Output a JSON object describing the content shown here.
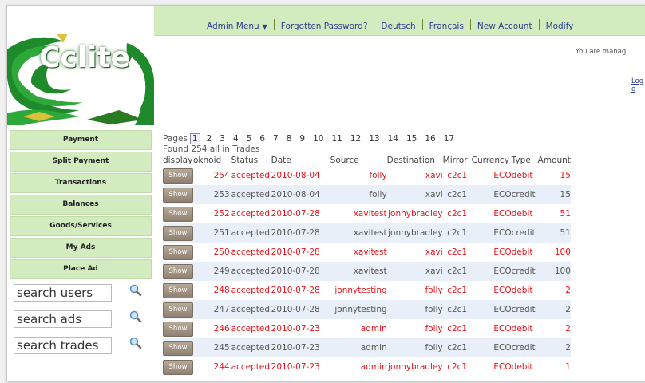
{
  "nav": {
    "items": [
      "Admin Menu",
      "Forgotten Password?",
      "Deutsch",
      "Français",
      "New Account",
      "Modify"
    ]
  },
  "logo": {
    "text": "Cclite"
  },
  "header": {
    "status_text": "You are manag",
    "logout_text": "Log o"
  },
  "sidebar": {
    "items": [
      "Payment",
      "Split Payment",
      "Transactions",
      "Balances",
      "Goods/Services",
      "My Ads",
      "Place Ad"
    ]
  },
  "search": {
    "users_placeholder": "search users",
    "ads_placeholder": "search ads",
    "trades_placeholder": "search trades"
  },
  "pagination": {
    "label": "Pages",
    "pages": [
      "1",
      "2",
      "3",
      "4",
      "5",
      "6",
      "7",
      "8",
      "9",
      "10",
      "11",
      "12",
      "13",
      "14",
      "15",
      "16",
      "17"
    ],
    "current": "1"
  },
  "found_text": "Found 254 all in Trades",
  "table": {
    "columns": [
      "display",
      "ok",
      "no",
      "id",
      "Status",
      "Date",
      "Source",
      "Destination",
      "Mirror",
      "Currency",
      "Type",
      "Amount"
    ],
    "button_label": "Show",
    "rows": [
      {
        "id": "254",
        "status": "accepted",
        "date": "2010-08-04",
        "source": "folly",
        "destination": "xavi",
        "mirror": "c2c1",
        "currency": "ECO",
        "type": "debit",
        "amount": "15"
      },
      {
        "id": "253",
        "status": "accepted",
        "date": "2010-08-04",
        "source": "folly",
        "destination": "xavi",
        "mirror": "c2c1",
        "currency": "ECO",
        "type": "credit",
        "amount": "15"
      },
      {
        "id": "252",
        "status": "accepted",
        "date": "2010-07-28",
        "source": "xavitest",
        "destination": "jonnybradley",
        "mirror": "c2c1",
        "currency": "ECO",
        "type": "debit",
        "amount": "51"
      },
      {
        "id": "251",
        "status": "accepted",
        "date": "2010-07-28",
        "source": "xavitest",
        "destination": "jonnybradley",
        "mirror": "c2c1",
        "currency": "ECO",
        "type": "credit",
        "amount": "51"
      },
      {
        "id": "250",
        "status": "accepted",
        "date": "2010-07-28",
        "source": "xavitest",
        "destination": "xavi",
        "mirror": "c2c1",
        "currency": "ECO",
        "type": "debit",
        "amount": "100"
      },
      {
        "id": "249",
        "status": "accepted",
        "date": "2010-07-28",
        "source": "xavitest",
        "destination": "xavi",
        "mirror": "c2c1",
        "currency": "ECO",
        "type": "credit",
        "amount": "100"
      },
      {
        "id": "248",
        "status": "accepted",
        "date": "2010-07-28",
        "source": "jonnytesting",
        "destination": "folly",
        "mirror": "c2c1",
        "currency": "ECO",
        "type": "debit",
        "amount": "2"
      },
      {
        "id": "247",
        "status": "accepted",
        "date": "2010-07-28",
        "source": "jonnytesting",
        "destination": "folly",
        "mirror": "c2c1",
        "currency": "ECO",
        "type": "credit",
        "amount": "2"
      },
      {
        "id": "246",
        "status": "accepted",
        "date": "2010-07-23",
        "source": "admin",
        "destination": "folly",
        "mirror": "c2c1",
        "currency": "ECO",
        "type": "debit",
        "amount": "2"
      },
      {
        "id": "245",
        "status": "accepted",
        "date": "2010-07-23",
        "source": "admin",
        "destination": "folly",
        "mirror": "c2c1",
        "currency": "ECO",
        "type": "credit",
        "amount": "2"
      },
      {
        "id": "244",
        "status": "accepted",
        "date": "2010-07-23",
        "source": "admin",
        "destination": "jonnybradley",
        "mirror": "c2c1",
        "currency": "ECO",
        "type": "debit",
        "amount": "1"
      }
    ]
  },
  "colors": {
    "nav_bg": "#d3ecbf",
    "debit_text": "#e8131b",
    "credit_row_bg": "#e9eff8",
    "link": "#2b3f8c"
  }
}
